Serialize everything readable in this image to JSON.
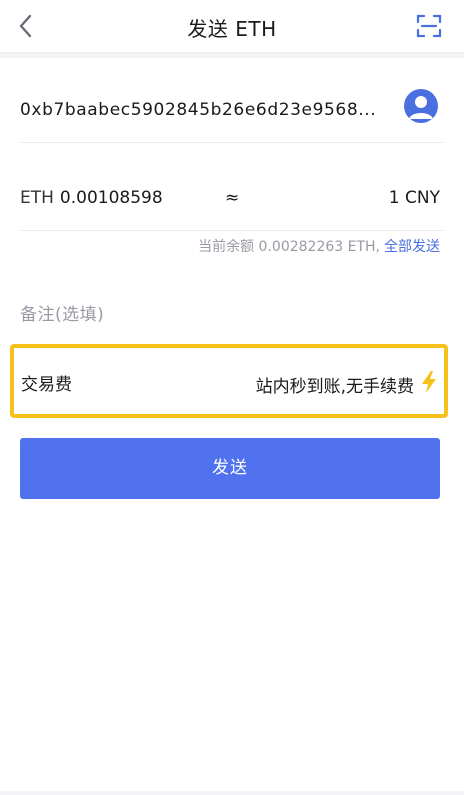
{
  "header": {
    "title": "发送 ETH"
  },
  "recipient": {
    "address": "0xb7baabec5902845b26e6d23e9568..."
  },
  "amount": {
    "unit": "ETH",
    "value": "0.00108598",
    "approx_symbol": "≈",
    "fiat": "1 CNY"
  },
  "balance": {
    "text": "当前余额 0.00282263 ETH,",
    "send_all_label": "全部发送"
  },
  "memo": {
    "placeholder": "备注(选填)"
  },
  "fee": {
    "label": "交易费",
    "value": "站内秒到账,无手续费",
    "icon": "lightning-icon"
  },
  "send_button": {
    "label": "发送"
  },
  "colors": {
    "accent": "#5172ee",
    "link": "#4a6fe0",
    "highlight_border": "#f5c11a",
    "bolt": "#f5c11a"
  }
}
